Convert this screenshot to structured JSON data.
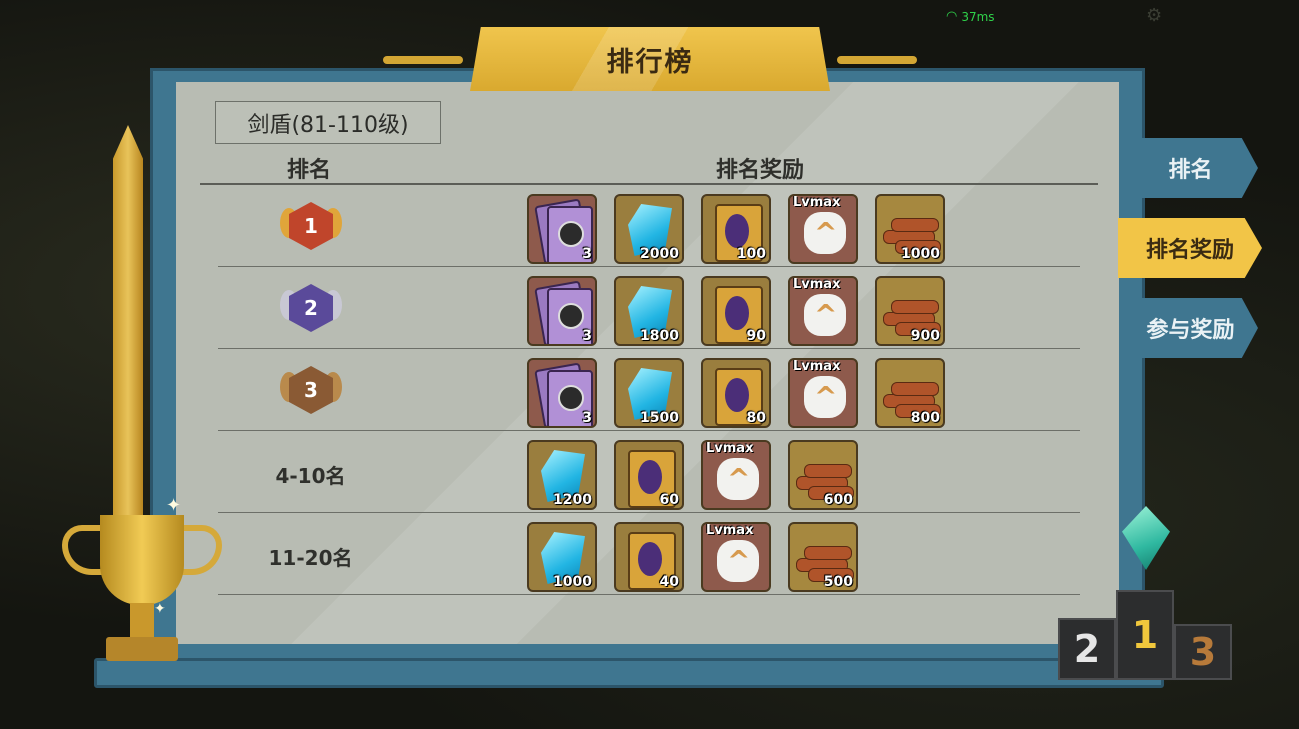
{
  "status": {
    "ping": "37ms"
  },
  "title": "排行榜",
  "category": "剑盾(81-110级)",
  "headers": {
    "rank": "排名",
    "reward": "排名奖励"
  },
  "tabs": [
    {
      "label": "排名",
      "active": false
    },
    {
      "label": "排名奖励",
      "active": true
    },
    {
      "label": "参与奖励",
      "active": false
    }
  ],
  "rows": [
    {
      "rank_label": "1",
      "medal": "gold-medal",
      "rewards": [
        {
          "icon": "summon-card-icon",
          "count": "3"
        },
        {
          "icon": "diamond-icon",
          "count": "2000"
        },
        {
          "icon": "skill-book-icon",
          "count": "100"
        },
        {
          "icon": "upgrade-stone-icon",
          "tag": "Lvmax"
        },
        {
          "icon": "wood-icon",
          "count": "1000"
        }
      ]
    },
    {
      "rank_label": "2",
      "medal": "silver-medal",
      "rewards": [
        {
          "icon": "summon-card-icon",
          "count": "3"
        },
        {
          "icon": "diamond-icon",
          "count": "1800"
        },
        {
          "icon": "skill-book-icon",
          "count": "90"
        },
        {
          "icon": "upgrade-stone-icon",
          "tag": "Lvmax"
        },
        {
          "icon": "wood-icon",
          "count": "900"
        }
      ]
    },
    {
      "rank_label": "3",
      "medal": "bronze-medal",
      "rewards": [
        {
          "icon": "summon-card-icon",
          "count": "3"
        },
        {
          "icon": "diamond-icon",
          "count": "1500"
        },
        {
          "icon": "skill-book-icon",
          "count": "80"
        },
        {
          "icon": "upgrade-stone-icon",
          "tag": "Lvmax"
        },
        {
          "icon": "wood-icon",
          "count": "800"
        }
      ]
    },
    {
      "rank_label": "4-10名",
      "rewards": [
        {
          "icon": "diamond-icon",
          "count": "1200"
        },
        {
          "icon": "skill-book-icon",
          "count": "60"
        },
        {
          "icon": "upgrade-stone-icon",
          "tag": "Lvmax"
        },
        {
          "icon": "wood-icon",
          "count": "600"
        }
      ]
    },
    {
      "rank_label": "11-20名",
      "rewards": [
        {
          "icon": "diamond-icon",
          "count": "1000"
        },
        {
          "icon": "skill-book-icon",
          "count": "40"
        },
        {
          "icon": "upgrade-stone-icon",
          "tag": "Lvmax"
        },
        {
          "icon": "wood-icon",
          "count": "500"
        }
      ]
    }
  ],
  "podium": [
    "2",
    "1",
    "3"
  ],
  "colors": {
    "frame": "#3f7690",
    "gold": "#f2c547",
    "panel": "#b8bcb3"
  }
}
